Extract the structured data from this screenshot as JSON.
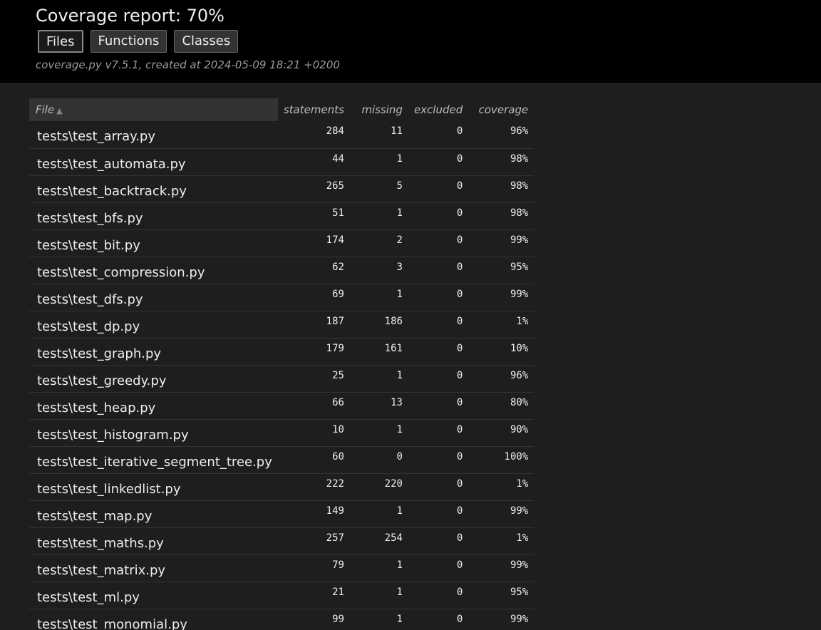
{
  "header": {
    "title": "Coverage report: 70%",
    "tabs": [
      "Files",
      "Functions",
      "Classes"
    ],
    "created": "coverage.py v7.5.1, created at 2024-05-09 18:21 +0200"
  },
  "table": {
    "columns": {
      "file": "File",
      "sort_arrow": "▲",
      "statements": "statements",
      "missing": "missing",
      "excluded": "excluded",
      "coverage": "coverage"
    },
    "rows": [
      {
        "file": "tests\\test_array.py",
        "statements": "284",
        "missing": "11",
        "excluded": "0",
        "coverage": "96%"
      },
      {
        "file": "tests\\test_automata.py",
        "statements": "44",
        "missing": "1",
        "excluded": "0",
        "coverage": "98%"
      },
      {
        "file": "tests\\test_backtrack.py",
        "statements": "265",
        "missing": "5",
        "excluded": "0",
        "coverage": "98%"
      },
      {
        "file": "tests\\test_bfs.py",
        "statements": "51",
        "missing": "1",
        "excluded": "0",
        "coverage": "98%"
      },
      {
        "file": "tests\\test_bit.py",
        "statements": "174",
        "missing": "2",
        "excluded": "0",
        "coverage": "99%"
      },
      {
        "file": "tests\\test_compression.py",
        "statements": "62",
        "missing": "3",
        "excluded": "0",
        "coverage": "95%"
      },
      {
        "file": "tests\\test_dfs.py",
        "statements": "69",
        "missing": "1",
        "excluded": "0",
        "coverage": "99%"
      },
      {
        "file": "tests\\test_dp.py",
        "statements": "187",
        "missing": "186",
        "excluded": "0",
        "coverage": "1%"
      },
      {
        "file": "tests\\test_graph.py",
        "statements": "179",
        "missing": "161",
        "excluded": "0",
        "coverage": "10%"
      },
      {
        "file": "tests\\test_greedy.py",
        "statements": "25",
        "missing": "1",
        "excluded": "0",
        "coverage": "96%"
      },
      {
        "file": "tests\\test_heap.py",
        "statements": "66",
        "missing": "13",
        "excluded": "0",
        "coverage": "80%"
      },
      {
        "file": "tests\\test_histogram.py",
        "statements": "10",
        "missing": "1",
        "excluded": "0",
        "coverage": "90%"
      },
      {
        "file": "tests\\test_iterative_segment_tree.py",
        "statements": "60",
        "missing": "0",
        "excluded": "0",
        "coverage": "100%"
      },
      {
        "file": "tests\\test_linkedlist.py",
        "statements": "222",
        "missing": "220",
        "excluded": "0",
        "coverage": "1%"
      },
      {
        "file": "tests\\test_map.py",
        "statements": "149",
        "missing": "1",
        "excluded": "0",
        "coverage": "99%"
      },
      {
        "file": "tests\\test_maths.py",
        "statements": "257",
        "missing": "254",
        "excluded": "0",
        "coverage": "1%"
      },
      {
        "file": "tests\\test_matrix.py",
        "statements": "79",
        "missing": "1",
        "excluded": "0",
        "coverage": "99%"
      },
      {
        "file": "tests\\test_ml.py",
        "statements": "21",
        "missing": "1",
        "excluded": "0",
        "coverage": "95%"
      },
      {
        "file": "tests\\test_monomial.py",
        "statements": "99",
        "missing": "1",
        "excluded": "0",
        "coverage": "99%"
      }
    ]
  }
}
